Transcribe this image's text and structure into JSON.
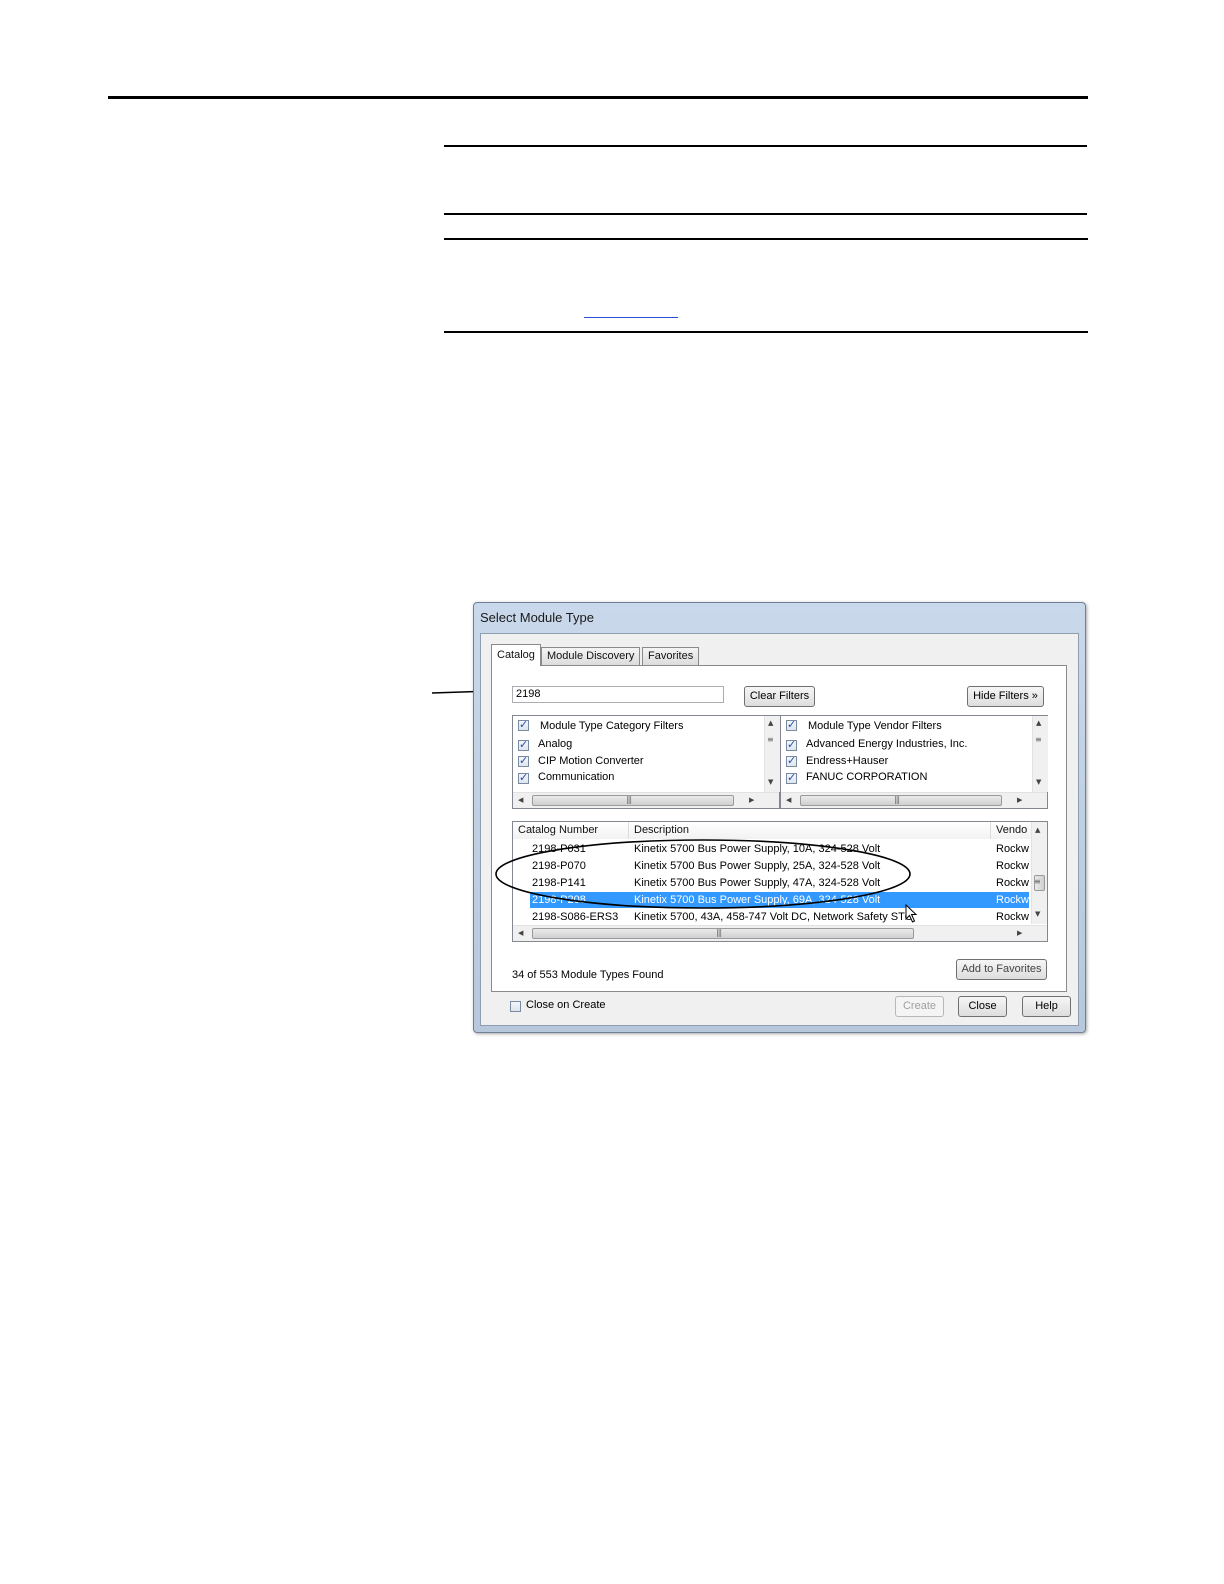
{
  "dialog": {
    "title": "Select Module Type",
    "tabs": [
      {
        "label": "Catalog",
        "active": true
      },
      {
        "label": "Module Discovery",
        "active": false
      },
      {
        "label": "Favorites",
        "active": false
      }
    ],
    "search": {
      "value": "2198"
    },
    "buttons": {
      "clear_filters": "Clear Filters",
      "hide_filters": "Hide Filters »",
      "add_to_favorites": "Add to Favorites",
      "create": "Create",
      "close": "Close",
      "help": "Help"
    },
    "category_filters": {
      "header": "Module Type Category Filters",
      "items": [
        {
          "label": "Analog",
          "checked": true
        },
        {
          "label": "CIP Motion Converter",
          "checked": true
        },
        {
          "label": "Communication",
          "checked": true
        }
      ]
    },
    "vendor_filters": {
      "header": "Module Type Vendor Filters",
      "items": [
        {
          "label": "Advanced Energy Industries, Inc.",
          "checked": true
        },
        {
          "label": "Endress+Hauser",
          "checked": true
        },
        {
          "label": "FANUC CORPORATION",
          "checked": true
        }
      ]
    },
    "catalog_table": {
      "columns": [
        "Catalog Number",
        "Description",
        "Vendo"
      ],
      "rows": [
        {
          "catalog": "2198-P031",
          "description": "Kinetix 5700 Bus Power Supply, 10A, 324-528 Volt",
          "vendor": "Rockw",
          "selected": false
        },
        {
          "catalog": "2198-P070",
          "description": "Kinetix 5700 Bus Power Supply, 25A, 324-528 Volt",
          "vendor": "Rockw",
          "selected": false
        },
        {
          "catalog": "2198-P141",
          "description": "Kinetix 5700 Bus Power Supply, 47A, 324-528 Volt",
          "vendor": "Rockw",
          "selected": false
        },
        {
          "catalog": "2198-P208",
          "description": "Kinetix 5700 Bus Power Supply, 69A, 324-528 Volt",
          "vendor": "Rockw",
          "selected": true
        },
        {
          "catalog": "2198-S086-ERS3",
          "description": "Kinetix 5700, 43A, 458-747 Volt DC, Network Safety STO",
          "vendor": "Rockw",
          "selected": false
        }
      ]
    },
    "found_text": "34 of 553 Module Types Found",
    "close_on_create": {
      "label": "Close on Create",
      "checked": false
    }
  },
  "colors": {
    "selection": "#3399ff",
    "link": "#2a50d8"
  }
}
